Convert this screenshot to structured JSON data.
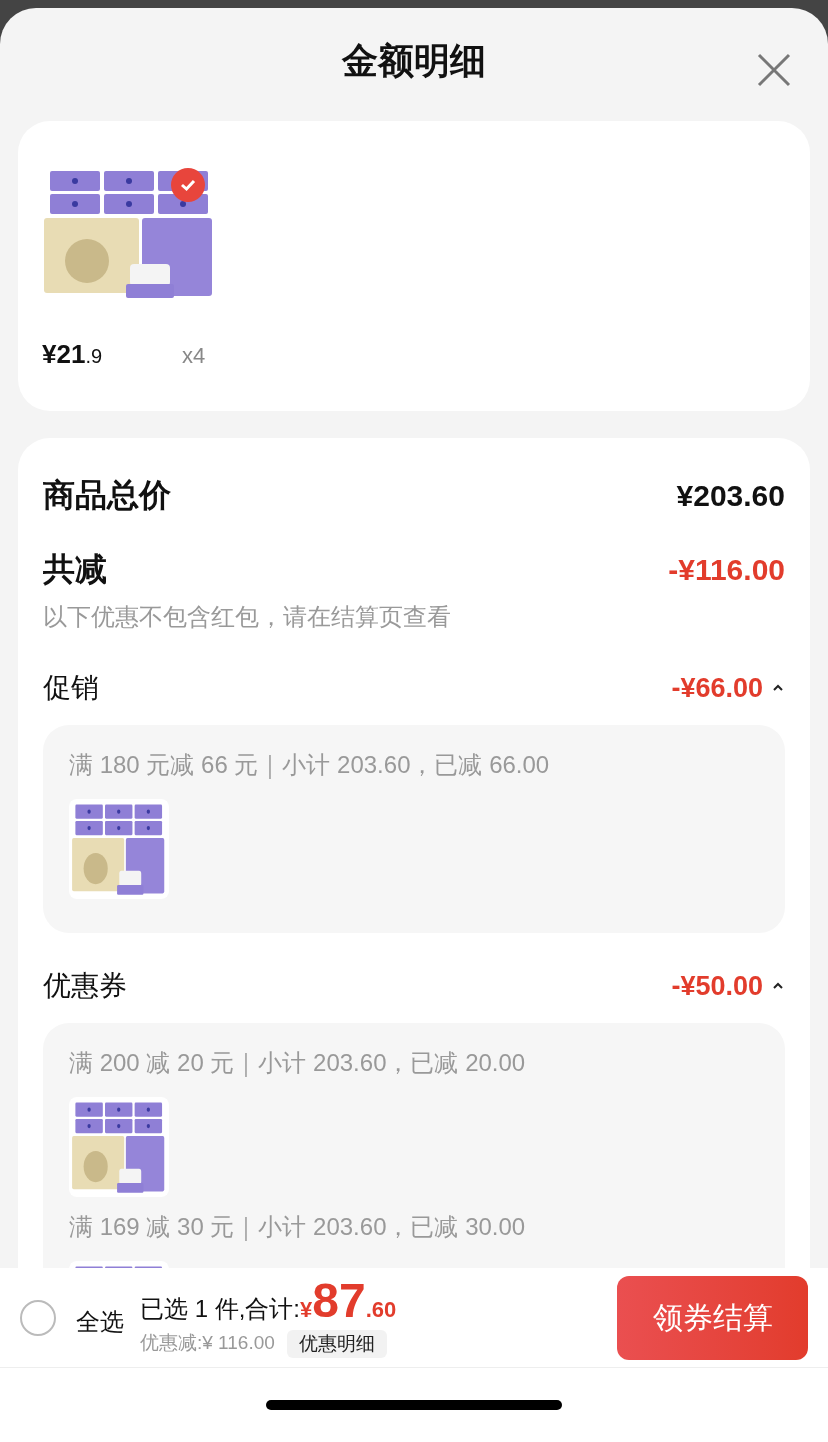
{
  "header": {
    "title": "金额明细"
  },
  "product": {
    "selected": true,
    "price_main": "¥21",
    "price_decimal": ".9",
    "quantity": "x4"
  },
  "summary": {
    "total_label": "商品总价",
    "total_value": "¥203.60",
    "discount_label": "共减",
    "discount_value": "-¥116.00",
    "note": "以下优惠不包含红包，请在结算页查看"
  },
  "groups": [
    {
      "title": "促销",
      "amount": "-¥66.00",
      "expanded": true,
      "rules": [
        {
          "text": "满 180 元减 66 元｜小计 203.60，已减 66.00"
        }
      ]
    },
    {
      "title": "优惠券",
      "amount": "-¥50.00",
      "expanded": true,
      "rules": [
        {
          "text": "满 200 减 20 元｜小计 203.60，已减 20.00"
        },
        {
          "text": "满 169 减 30 元｜小计 203.60，已减 30.00"
        }
      ]
    }
  ],
  "footer": {
    "select_all": {
      "label": "全选",
      "checked": false
    },
    "summary": "已选 1 件,合计:",
    "currency": "¥",
    "total_integer": "87",
    "total_decimal": ".60",
    "discount": "优惠减:¥ 116.00",
    "details_button": "优惠明细",
    "checkout_button": "领券结算"
  }
}
